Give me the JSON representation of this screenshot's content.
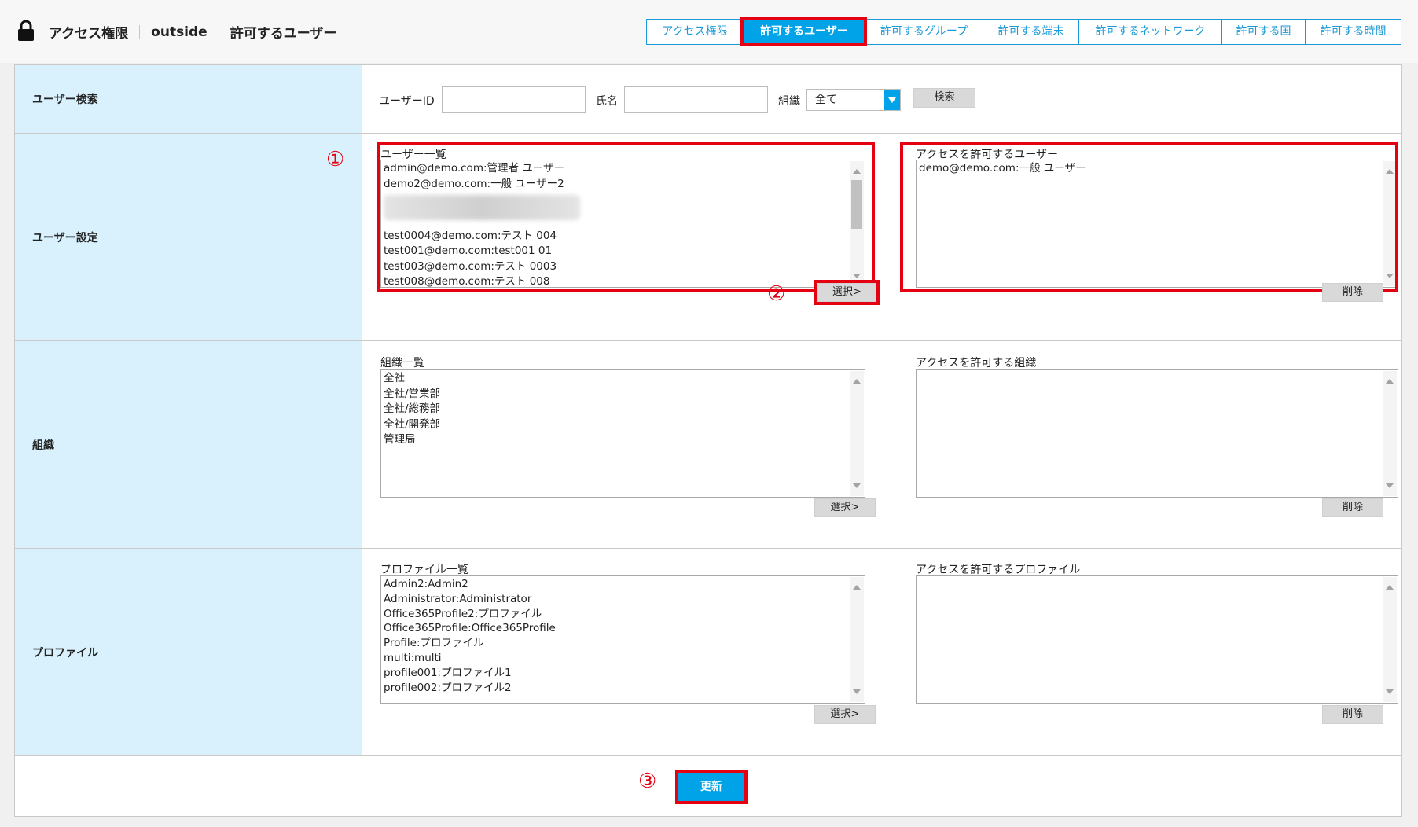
{
  "header": {
    "breadcrumb": [
      "アクセス権限",
      "outside",
      "許可するユーザー"
    ],
    "tabs": [
      {
        "label": "アクセス権限",
        "active": false
      },
      {
        "label": "許可するユーザー",
        "active": true
      },
      {
        "label": "許可するグループ",
        "active": false
      },
      {
        "label": "許可する端末",
        "active": false
      },
      {
        "label": "許可するネットワーク",
        "active": false
      },
      {
        "label": "許可する国",
        "active": false
      },
      {
        "label": "許可する時間",
        "active": false
      }
    ]
  },
  "search": {
    "row_label": "ユーザー検索",
    "user_id_label": "ユーザーID",
    "user_id_value": "",
    "name_label": "氏名",
    "name_value": "",
    "org_label": "組織",
    "org_selected": "全て",
    "search_button": "検索"
  },
  "user_settings": {
    "row_label": "ユーザー設定",
    "list_title": "ユーザー一覧",
    "list_items": [
      "admin@demo.com:管理者 ユーザー",
      "demo2@demo.com:一般 ユーザー2",
      "",
      "test0004@demo.com:テスト 004",
      "test001@demo.com:test001 01",
      "test003@demo.com:テスト 0003",
      "test008@demo.com:テスト 008"
    ],
    "allowed_title": "アクセスを許可するユーザー",
    "allowed_items": [
      "demo@demo.com:一般 ユーザー"
    ],
    "select_button": "選択>",
    "delete_button": "削除"
  },
  "organizations": {
    "row_label": "組織",
    "list_title": "組織一覧",
    "list_items": [
      "全社",
      "全社/営業部",
      "全社/総務部",
      "全社/開発部",
      "管理局"
    ],
    "allowed_title": "アクセスを許可する組織",
    "allowed_items": [],
    "select_button": "選択>",
    "delete_button": "削除"
  },
  "profiles": {
    "row_label": "プロファイル",
    "list_title": "プロファイル一覧",
    "list_items": [
      "Admin2:Admin2",
      "Administrator:Administrator",
      "Office365Profile2:プロファイル",
      "Office365Profile:Office365Profile",
      "Profile:プロファイル",
      "multi:multi",
      "profile001:プロファイル1",
      "profile002:プロファイル2"
    ],
    "allowed_title": "アクセスを許可するプロファイル",
    "allowed_items": [],
    "select_button": "選択>",
    "delete_button": "削除"
  },
  "update_button": "更新",
  "annotations": {
    "marker_1": "①",
    "marker_2": "②",
    "marker_3": "③"
  },
  "colors": {
    "accent": "#00a3e8",
    "highlight": "#e50012",
    "label_bg": "#d9f1fd"
  }
}
